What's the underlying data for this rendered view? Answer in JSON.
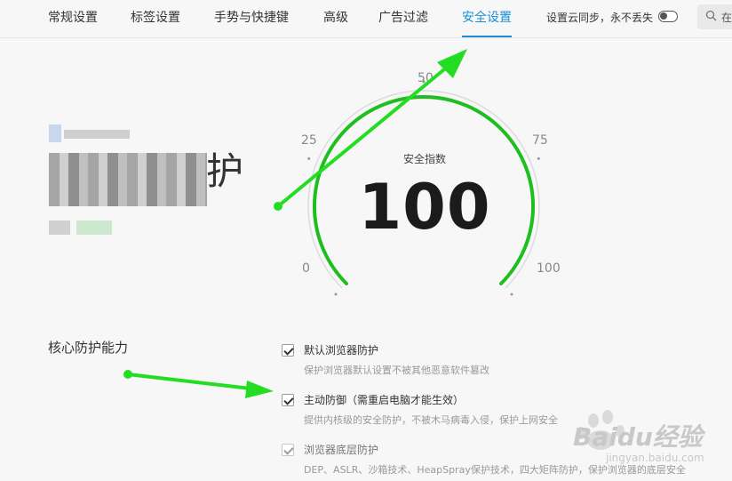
{
  "tabs": [
    {
      "label": "常规设置",
      "active": false
    },
    {
      "label": "标签设置",
      "active": false
    },
    {
      "label": "手势与快捷键",
      "active": false
    },
    {
      "label": "高级",
      "active": false
    },
    {
      "label": "广告过滤",
      "active": false
    },
    {
      "label": "安全设置",
      "active": true
    }
  ],
  "sync": {
    "label": "设置云同步，永不丢失",
    "enabled": false
  },
  "search": {
    "placeholder": "在"
  },
  "hero": {
    "visible_char": "护"
  },
  "gauge": {
    "title": "安全指数",
    "value": "100",
    "min": 0,
    "max": 100,
    "level": 100,
    "ticks": [
      "0",
      "25",
      "50",
      "75",
      "100"
    ],
    "color": "#1ebe1e"
  },
  "section": {
    "title": "核心防护能力",
    "options": [
      {
        "label": "默认浏览器防护",
        "desc": "保护浏览器默认设置不被其他恶意软件篡改",
        "checked": true,
        "disabled": false
      },
      {
        "label": "主动防御（需重启电脑才能生效）",
        "desc": "提供内核级的安全防护，不被木马病毒入侵，保护上网安全",
        "checked": true,
        "disabled": false
      },
      {
        "label": "浏览器底层防护",
        "desc": "DEP、ASLR、沙箱技术、HeapSpray保护技术，四大矩阵防护，保护浏览器的底层安全",
        "checked": true,
        "disabled": true
      }
    ]
  },
  "colors": {
    "accent": "#1a8fd8",
    "annotation": "#22dd22"
  },
  "watermark": {
    "text": "Baidu经验",
    "sub": "jingyan.baidu.com"
  }
}
